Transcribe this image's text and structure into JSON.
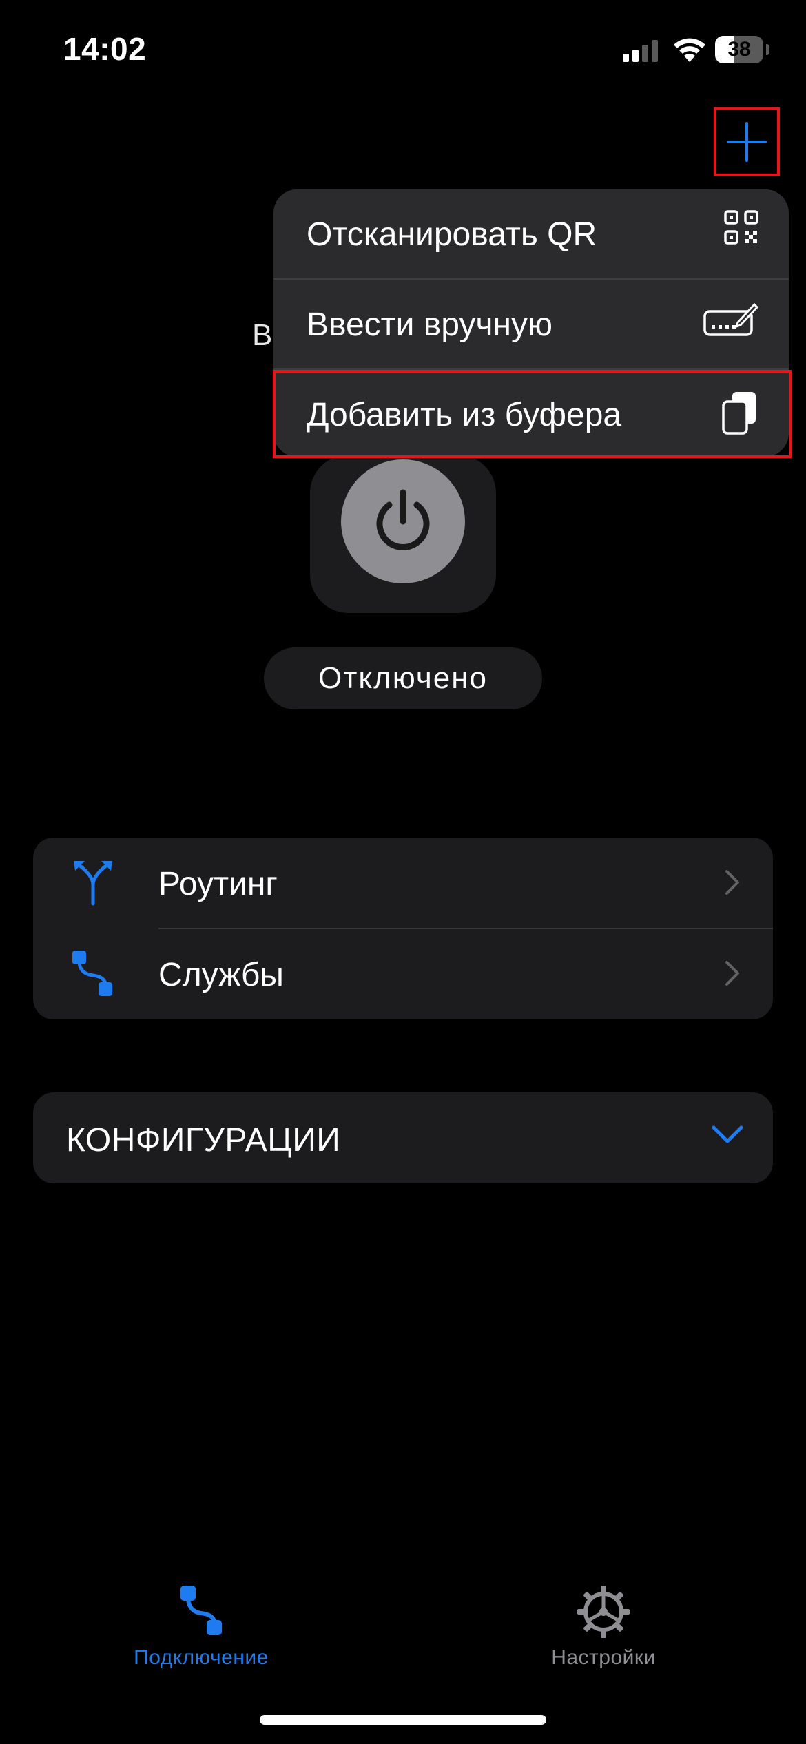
{
  "status_bar": {
    "time": "14:02",
    "battery_level": "38"
  },
  "header": {
    "hidden_title_fragment": "В"
  },
  "add_menu": {
    "items": [
      {
        "label": "Отсканировать QR",
        "icon": "qr-code-icon"
      },
      {
        "label": "Ввести вручную",
        "icon": "keyboard-pencil-icon"
      },
      {
        "label": "Добавить из буфера",
        "icon": "clipboard-copy-icon"
      }
    ]
  },
  "connection": {
    "status": "Отключено"
  },
  "list": {
    "items": [
      {
        "label": "Роутинг",
        "icon": "routing-fork-icon"
      },
      {
        "label": "Службы",
        "icon": "services-path-icon"
      }
    ]
  },
  "configs": {
    "title": "КОНФИГУРАЦИИ"
  },
  "tabbar": {
    "tabs": [
      {
        "label": "Подключение",
        "icon": "connection-path-icon",
        "active": true
      },
      {
        "label": "Настройки",
        "icon": "gear-icon",
        "active": false
      }
    ]
  },
  "colors": {
    "accent": "#1e7cf0",
    "background": "#000000",
    "card": "#1c1c1e",
    "menu": "#2b2b2d",
    "highlight_border": "#e3161c",
    "inactive_tab": "#8e8e93"
  }
}
